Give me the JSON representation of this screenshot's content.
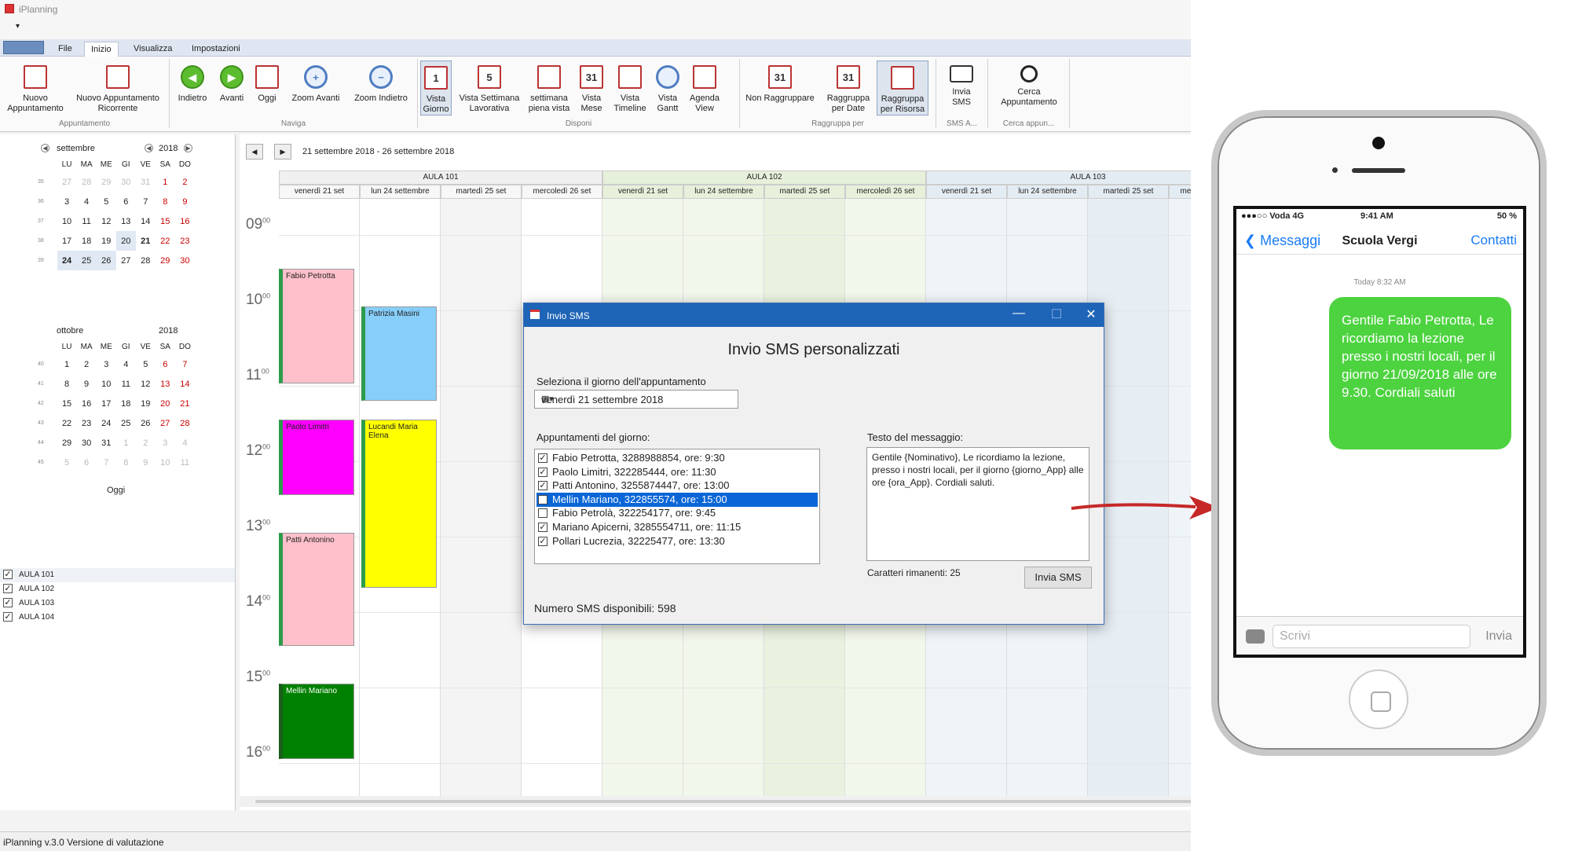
{
  "window": {
    "title": "iPlanning",
    "status": "iPlanning v.3.0 Versione di valutazione"
  },
  "tabs": [
    "File",
    "Inizio",
    "Visualizza",
    "Impostazioni"
  ],
  "ribbon": {
    "groups": [
      "Appuntamento",
      "Naviga",
      "Disponi",
      "Raggruppa per",
      "SMS A...",
      "Cerca appun..."
    ],
    "buttons": [
      "Nuovo Appuntamento",
      "Nuovo Appuntamento Ricorrente",
      "Indietro",
      "Avanti",
      "Oggi",
      "Zoom Avanti",
      "Zoom Indietro",
      "Vista Giorno",
      "Vista Settimana Lavorativa",
      "settimana piena vista",
      "Vista Mese",
      "Vista Timeline",
      "Vista Gantt",
      "Agenda View",
      "Non Raggruppare",
      "Raggruppa per Date",
      "Raggruppa per Risorsa",
      "Invia SMS",
      "Cerca Appuntamento"
    ],
    "icon_text": {
      "giorno": "1",
      "settimana": "5",
      "mese": "31",
      "nonragg": "31",
      "raggdate": "31"
    }
  },
  "sidebar": {
    "sept": {
      "month": "settembre",
      "year": "2018"
    },
    "oct": {
      "month": "ottobre",
      "year": "2018"
    },
    "weekdays": [
      "LU",
      "MA",
      "ME",
      "GI",
      "VE",
      "SA",
      "DO"
    ],
    "oggi": "Oggi",
    "resources": [
      "AULA 101",
      "AULA 102",
      "AULA 103",
      "AULA 104"
    ]
  },
  "scheduler": {
    "range": "21 settembre 2018 - 26 settembre 2018",
    "aule": [
      "AULA 101",
      "AULA 102",
      "AULA 103"
    ],
    "days": [
      "venerdì 21 set",
      "lun 24 settembre",
      "martedì 25 set",
      "mercoledì 26 set"
    ],
    "days_cut": [
      "mercoledì",
      "set"
    ],
    "hours": [
      "09",
      "10",
      "11",
      "12",
      "13",
      "14",
      "15",
      "16"
    ],
    "minutes": "00",
    "appointments": [
      {
        "name": "Fabio Petrotta",
        "color": "#ffc0cb"
      },
      {
        "name": "Patrizia Masini",
        "color": "#87cefa"
      },
      {
        "name": "Paolo Limitri",
        "color": "#ff00ff"
      },
      {
        "name": "Lucandi Maria Elena",
        "color": "#ffff00"
      },
      {
        "name": "Patti Antonino",
        "color": "#ffc0cb"
      },
      {
        "name": "Mellin Mariano",
        "color": "#008000"
      }
    ]
  },
  "dialog": {
    "title": "Invio SMS",
    "heading": "Invio SMS personalizzati",
    "date_label": "Seleziona il giorno dell'appuntamento",
    "date_value": "venerdì   21 settembre 2018",
    "list_label": "Appuntamenti del giorno:",
    "items": [
      {
        "text": "Fabio Petrotta, 3288988854, ore: 9:30",
        "checked": true
      },
      {
        "text": "Paolo Limitri, 322285444, ore: 11:30",
        "checked": true
      },
      {
        "text": "Patti Antonino, 3255874447, ore: 13:00",
        "checked": true
      },
      {
        "text": "Mellin Mariano, 322855574, ore: 15:00",
        "checked": false
      },
      {
        "text": "Fabio Petrolà, 322254177, ore: 9:45",
        "checked": false
      },
      {
        "text": "Mariano Apicerni, 3285554711, ore: 11:15",
        "checked": true
      },
      {
        "text": "Pollari Lucrezia, 32225477, ore: 13:30",
        "checked": true
      }
    ],
    "msg_label": "Testo del messaggio:",
    "msg_text": "Gentile {Nominativo}, Le ricordiamo la lezione, presso i nostri locali, per il giorno {giorno_App} alle ore {ora_App}. Cordiali saluti.",
    "chars_left": "Caratteri rimanenti: 25",
    "send": "Invia SMS",
    "available": "Numero SMS disponibili: 598"
  },
  "phone": {
    "carrier": "●●●○○ Voda  4G",
    "time": "9:41 AM",
    "battery": "50 %",
    "back": "Messaggi",
    "contact": "Scuola Vergi",
    "contacts": "Contatti",
    "timestamp": "Today 8:32 AM",
    "message": "Gentile Fabio Petrotta, Le ricordiamo la lezione presso i nostri locali, per il giorno 21/09/2018 alle ore 9.30. Cordiali saluti",
    "placeholder": "Scrivi",
    "send": "Invia"
  }
}
